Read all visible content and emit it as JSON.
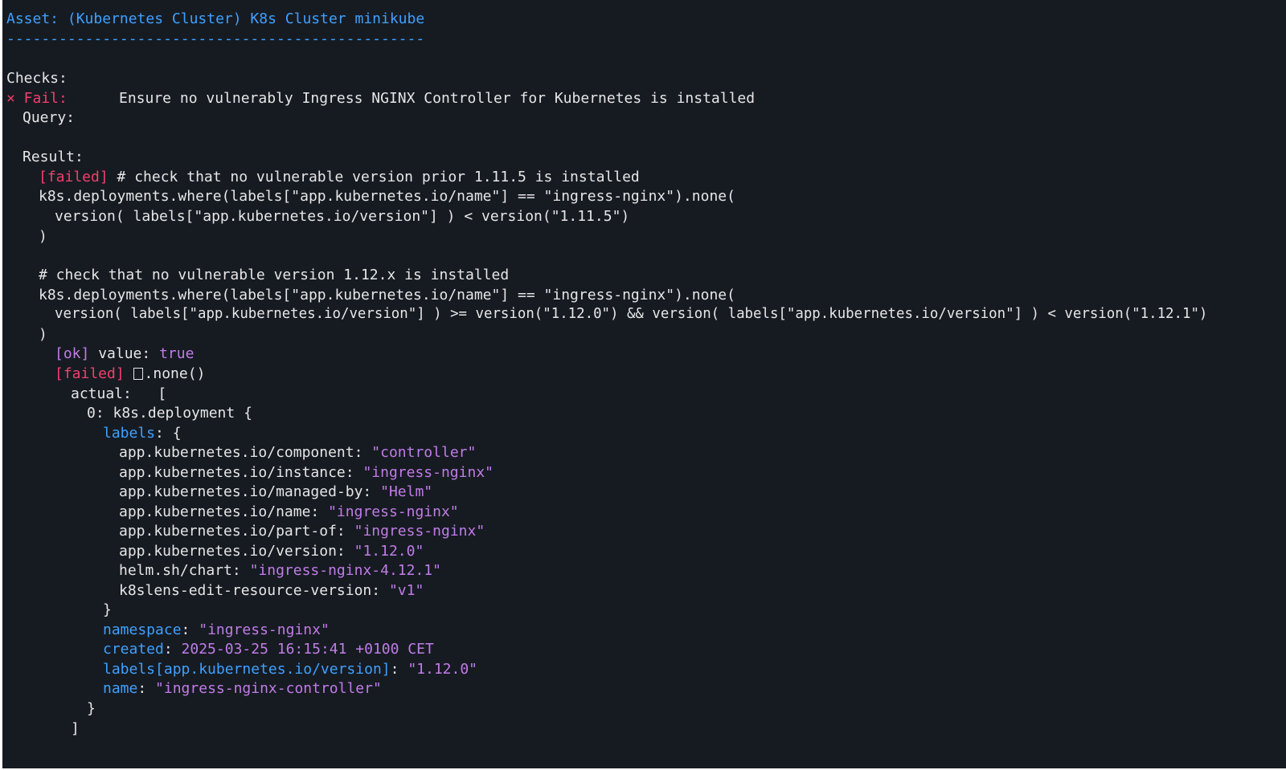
{
  "asset_header": {
    "label": "Asset: (Kubernetes Cluster) K8s Cluster minikube",
    "rule": "------------------------------------------------"
  },
  "checks": {
    "heading": "Checks:",
    "fail_marker": "× Fail:",
    "fail_title": "Ensure no vulnerably Ingress NGINX Controller for Kubernetes is installed",
    "query_label": "Query:",
    "result_label": "Result:"
  },
  "result": {
    "failed_tag": "[failed]",
    "comment1": " # check that no vulnerable version prior 1.11.5 is installed",
    "code1_line1": "k8s.deployments.where(labels[\"app.kubernetes.io/name\"] == \"ingress-nginx\").none(",
    "code1_line2": "version( labels[\"app.kubernetes.io/version\"] ) < version(\"1.11.5\")",
    "code1_line3": ")",
    "comment2": "# check that no vulnerable version 1.12.x is installed",
    "code2_line1": "k8s.deployments.where(labels[\"app.kubernetes.io/name\"] == \"ingress-nginx\").none(",
    "code2_line2": "version( labels[\"app.kubernetes.io/version\"] ) >= version(\"1.12.0\") && version( labels[\"app.kubernetes.io/version\"] ) < version(\"1.12.1\")",
    "code2_line3": ")",
    "ok_tag": "[ok]",
    "ok_value_label": " value: ",
    "ok_value": "true",
    "failed_tag2": "[failed]",
    "none_call": ".none()",
    "actual_label": "actual:   [",
    "item_header": "0: k8s.deployment {",
    "labels_key": "labels",
    "labels_open": ": {",
    "labels": [
      {
        "key": "app.kubernetes.io/component: ",
        "value": "\"controller\""
      },
      {
        "key": "app.kubernetes.io/instance: ",
        "value": "\"ingress-nginx\""
      },
      {
        "key": "app.kubernetes.io/managed-by: ",
        "value": "\"Helm\""
      },
      {
        "key": "app.kubernetes.io/name: ",
        "value": "\"ingress-nginx\""
      },
      {
        "key": "app.kubernetes.io/part-of: ",
        "value": "\"ingress-nginx\""
      },
      {
        "key": "app.kubernetes.io/version: ",
        "value": "\"1.12.0\""
      },
      {
        "key": "helm.sh/chart: ",
        "value": "\"ingress-nginx-4.12.1\""
      },
      {
        "key": "k8slens-edit-resource-version: ",
        "value": "\"v1\""
      }
    ],
    "labels_close": "}",
    "fields": [
      {
        "key": "namespace",
        "value": "\"ingress-nginx\""
      },
      {
        "key": "created",
        "value": "2025-03-25 16:15:41 +0100 CET"
      },
      {
        "key": "labels[app.kubernetes.io/version]",
        "value": "\"1.12.0\""
      },
      {
        "key": "name",
        "value": "\"ingress-nginx-controller\""
      }
    ],
    "field_sep": ": ",
    "item_close": "}",
    "array_close": "]"
  },
  "colors": {
    "background": "#161b22",
    "text": "#e6e6e6",
    "accent_blue": "#3fa0ff",
    "fail_red": "#f43f6b",
    "value_purple": "#c07ce6"
  }
}
